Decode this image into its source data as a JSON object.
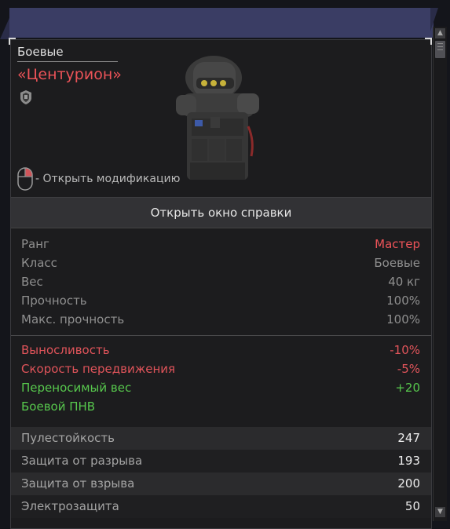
{
  "header": {
    "category": "Боевые",
    "item_name": "«Центурион»",
    "mouse_hint": "- Открыть модификацию"
  },
  "help_button_label": "Открыть окно справки",
  "stats": [
    {
      "label": "Ранг",
      "value": "Мастер"
    },
    {
      "label": "Класс",
      "value": "Боевые"
    },
    {
      "label": "Вес",
      "value": "40 кг"
    },
    {
      "label": "Прочность",
      "value": "100%"
    },
    {
      "label": "Макс. прочность",
      "value": "100%"
    }
  ],
  "modifiers": [
    {
      "label": "Выносливость",
      "value": "-10%"
    },
    {
      "label": "Скорость передвижения",
      "value": "-5%"
    },
    {
      "label": "Переносимый вес",
      "value": "+20"
    },
    {
      "label": "Боевой ПНВ",
      "value": ""
    }
  ],
  "protection": [
    {
      "label": "Пулестойкость",
      "value": "247"
    },
    {
      "label": "Защита от разрыва",
      "value": "193"
    },
    {
      "label": "Защита от взрыва",
      "value": "200"
    },
    {
      "label": "Электрозащита",
      "value": "50"
    }
  ],
  "colors": {
    "accent_red": "#ec5358",
    "positive_green": "#57c84d",
    "top_bar": "#3a3d64",
    "panel": "#1c1c1e"
  },
  "icons": {
    "faction": "shield-icon",
    "mouse": "mouse-right-click-icon",
    "scroll_up": "arrow-up-icon",
    "scroll_down": "arrow-down-icon"
  }
}
